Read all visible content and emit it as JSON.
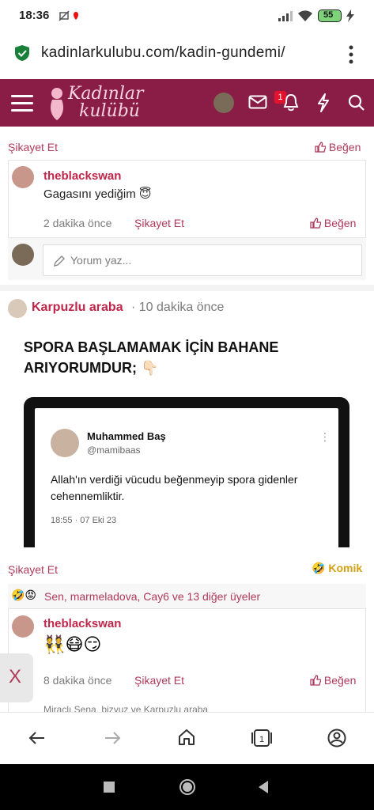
{
  "status": {
    "time": "18:36",
    "battery": "55"
  },
  "browser": {
    "url": "kadinlarkulubu.com/kadin-gundemi/"
  },
  "header": {
    "logo_line1": "Kadınlar",
    "logo_line2": "kulübü",
    "notif_badge": "1"
  },
  "comment1": {
    "report": "Şikayet Et",
    "like": "Beğen"
  },
  "reply1": {
    "author": "theblackswan",
    "text": "Gagasını yediğim 😇",
    "time": "2 dakika önce",
    "report": "Şikayet Et",
    "like": "Beğen"
  },
  "comment_input": {
    "placeholder": "Yorum yaz..."
  },
  "post": {
    "author": "Karpuzlu araba",
    "time": "· 10 dakika önce",
    "image_headline": "SPORA BAŞLAMAMAK İÇİN BAHANE ARIYORUMDUR; 👇🏻",
    "tweet_name": "Muhammed Baş",
    "tweet_handle": "@mamibaas",
    "tweet_text": "Allah'ın verdiği vücudu beğenmeyip spora gidenler cehennemliktir.",
    "tweet_time": "18:55 · 07 Eki 23",
    "report": "Şikayet Et",
    "reaction_label": "Komik",
    "reaction_summary": "Sen, marmeladova, Cay6 ve 13 diğer üyeler"
  },
  "reply2": {
    "author": "theblackswan",
    "emojis": "👯😷😏",
    "time": "8 dakika önce",
    "report": "Şikayet Et",
    "like": "Beğen",
    "partial": "Miraclı Sena, bizyuz ve Karpuzlu araba"
  },
  "side_tab": {
    "label": "X"
  }
}
